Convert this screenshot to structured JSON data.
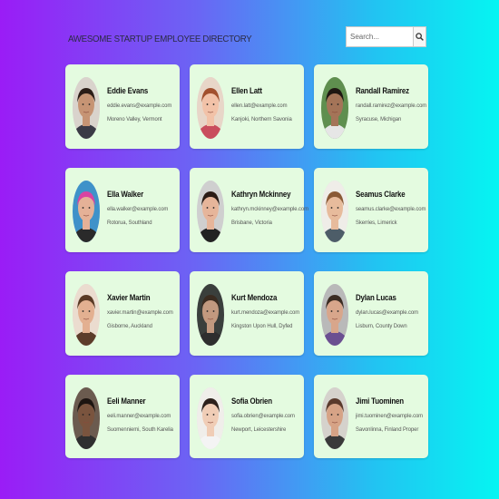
{
  "header": {
    "title": "AWESOME STARTUP EMPLOYEE DIRECTORY",
    "search_placeholder": "Search...",
    "search_icon": "magnifier-icon"
  },
  "employees": [
    {
      "name": "Eddie Evans",
      "email": "eddie.evans@example.com",
      "location": "Moreno Valley, Vermont",
      "skin": "#c69474",
      "hair": "#2b1d17",
      "bg": "#d9d3cc",
      "shirt": "#3b3b46"
    },
    {
      "name": "Ellen Latt",
      "email": "ellen.latt@example.com",
      "location": "Kanjoki, Northern Savonia",
      "skin": "#f2c2a8",
      "hair": "#a2502e",
      "bg": "#e8d6c8",
      "shirt": "#c94d5d"
    },
    {
      "name": "Randall Ramirez",
      "email": "randall.ramirez@example.com",
      "location": "Syracuse, Michigan",
      "skin": "#a47458",
      "hair": "#1f1712",
      "bg": "#5f8f4f",
      "shirt": "#e6e6e6"
    },
    {
      "name": "Ella Walker",
      "email": "ella.walker@example.com",
      "location": "Rotorua, Southland",
      "skin": "#e5b197",
      "hair": "#d843a2",
      "bg": "#3f92c9",
      "shirt": "#2a2a2a"
    },
    {
      "name": "Kathryn Mckinney",
      "email": "kathryn.mckinney@example.com",
      "location": "Brisbane, Victoria",
      "skin": "#e6b59a",
      "hair": "#2a1b15",
      "bg": "#cfcfcf",
      "shirt": "#222222"
    },
    {
      "name": "Seamus Clarke",
      "email": "seamus.clarke@example.com",
      "location": "Skerries, Limerick",
      "skin": "#e7bb9c",
      "hair": "#8a5a36",
      "bg": "#efede8",
      "shirt": "#4d5d68"
    },
    {
      "name": "Xavier Martin",
      "email": "xavier.martin@example.com",
      "location": "Gisborne, Auckland",
      "skin": "#e3b091",
      "hair": "#5a3a25",
      "bg": "#ebdccf",
      "shirt": "#5c3c2a"
    },
    {
      "name": "Kurt Mendoza",
      "email": "kurt.mendoza@example.com",
      "location": "Kingston Upon Hull, Dyfed",
      "skin": "#c2997f",
      "hair": "#3a2b20",
      "bg": "#3a3f3c",
      "shirt": "#2e2e2e"
    },
    {
      "name": "Dylan Lucas",
      "email": "dylan.lucas@example.com",
      "location": "Lisburn, County Down",
      "skin": "#d8a68b",
      "hair": "#3c2d23",
      "bg": "#b9b9b9",
      "shirt": "#6b4f91"
    },
    {
      "name": "Eeli Manner",
      "email": "eeli.manner@example.com",
      "location": "Suomenniemi, South Karelia",
      "skin": "#7a543e",
      "hair": "#1d1511",
      "bg": "#6b5b4f",
      "shirt": "#2f2f2f"
    },
    {
      "name": "Sofia Obrien",
      "email": "sofia.obrien@example.com",
      "location": "Newport, Leicestershire",
      "skin": "#f0cdb6",
      "hair": "#2d211c",
      "bg": "#f0eeea",
      "shirt": "#f4f4f4"
    },
    {
      "name": "Jimi Tuominen",
      "email": "jimi.tuominen@example.com",
      "location": "Savonlinna, Finland Proper",
      "skin": "#d6a386",
      "hair": "#5a3a2c",
      "bg": "#d5d2cc",
      "shirt": "#3a3a3a"
    }
  ]
}
